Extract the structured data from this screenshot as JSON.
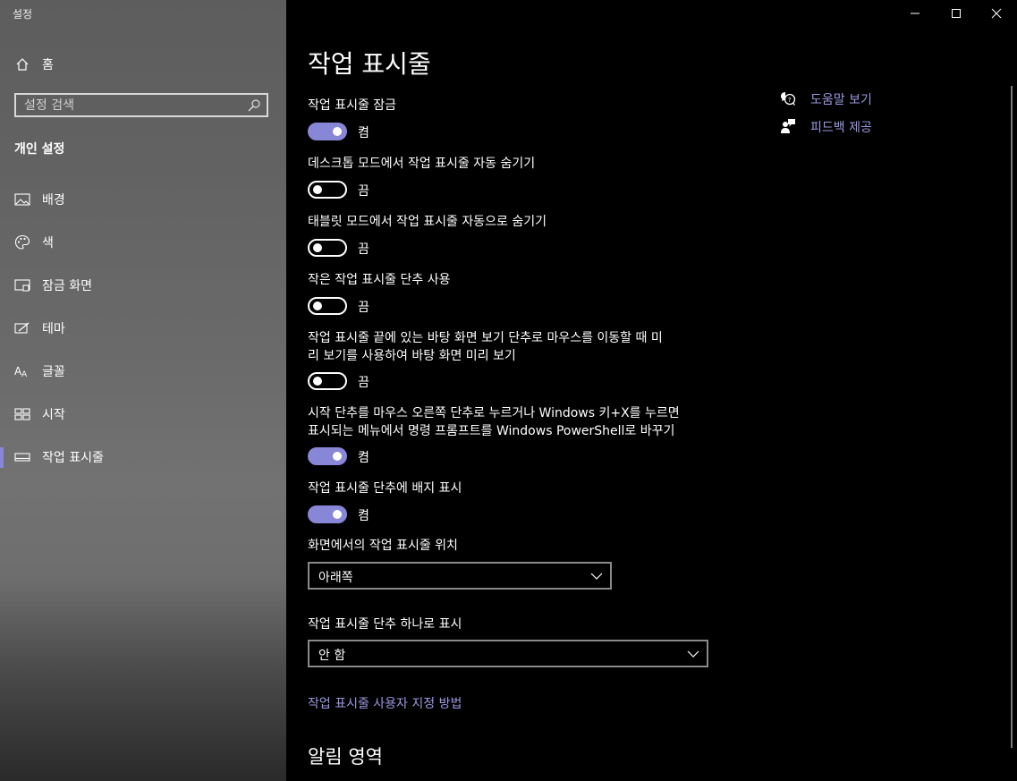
{
  "app": {
    "title": "설정"
  },
  "sidebar": {
    "home_label": "홈",
    "search_placeholder": "설정 검색",
    "section_heading": "개인 설정",
    "items": [
      {
        "label": "배경",
        "icon": "picture-icon"
      },
      {
        "label": "색",
        "icon": "palette-icon"
      },
      {
        "label": "잠금 화면",
        "icon": "lock-screen-icon"
      },
      {
        "label": "테마",
        "icon": "theme-icon"
      },
      {
        "label": "글꼴",
        "icon": "font-icon"
      },
      {
        "label": "시작",
        "icon": "start-icon"
      },
      {
        "label": "작업 표시줄",
        "icon": "taskbar-icon",
        "selected": true
      }
    ]
  },
  "main": {
    "title": "작업 표시줄",
    "settings": [
      {
        "label": "작업 표시줄 잠금",
        "state": "켬",
        "on": true
      },
      {
        "label": "데스크톱 모드에서 작업 표시줄 자동 숨기기",
        "state": "끔",
        "on": false
      },
      {
        "label": "태블릿 모드에서 작업 표시줄 자동으로 숨기기",
        "state": "끔",
        "on": false
      },
      {
        "label": "작은 작업 표시줄 단추 사용",
        "state": "끔",
        "on": false
      },
      {
        "label_line1": "작업 표시줄 끝에 있는 바탕 화면 보기 단추로 마우스를 이동할 때 미",
        "label_line2": "리 보기를 사용하여 바탕 화면 미리 보기",
        "state": "끔",
        "on": false
      },
      {
        "label_line1": "시작 단추를 마우스 오른쪽 단추로 누르거나 Windows 키+X를 누르면",
        "label_line2": "표시되는 메뉴에서 명령 프롬프트를 Windows PowerShell로 바꾸기",
        "state": "켬",
        "on": true
      },
      {
        "label": "작업 표시줄 단추에 배지 표시",
        "state": "켬",
        "on": true
      }
    ],
    "position": {
      "label": "화면에서의 작업 표시줄 위치",
      "value": "아래쪽"
    },
    "combine": {
      "label": "작업 표시줄 단추 하나로 표시",
      "value": "안 함"
    },
    "customize_link": "작업 표시줄 사용자 지정 방법",
    "notification_section": "알림 영역"
  },
  "help": {
    "help_label": "도움말 보기",
    "feedback_label": "피드백 제공"
  },
  "colors": {
    "accent": "#8886d6",
    "link": "#9a98e0",
    "background": "#000000"
  }
}
